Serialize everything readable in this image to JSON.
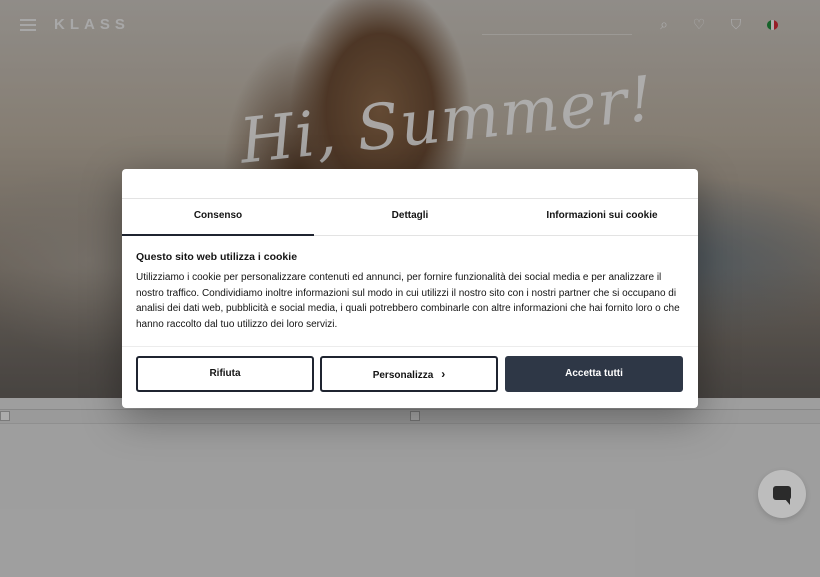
{
  "header": {
    "logo": "KLASS",
    "icons": [
      "menu-icon",
      "search-icon",
      "heart-icon",
      "cart-icon",
      "italian-flag-icon"
    ]
  },
  "hero": {
    "script_text": "Hi, Summer!"
  },
  "cookie_dialog": {
    "tabs": [
      {
        "label": "Consenso",
        "active": true
      },
      {
        "label": "Dettagli",
        "active": false
      },
      {
        "label": "Informazioni sui cookie",
        "active": false
      }
    ],
    "title": "Questo sito web utilizza i cookie",
    "body": "Utilizziamo i cookie per personalizzare contenuti ed annunci, per fornire funzionalità dei social media e per analizzare il nostro traffico. Condividiamo inoltre informazioni sul modo in cui utilizzi il nostro sito con i nostri partner che si occupano di analisi dei dati web, pubblicità e social media, i quali potrebbero combinarle con altre informazioni che hai fornito loro o che hanno raccolto dal tuo utilizzo dei loro servizi.",
    "buttons": {
      "reject": "Rifiuta",
      "customize": "Personalizza",
      "accept": "Accetta tutti"
    },
    "accent_color": "#2e3746"
  },
  "chat": {
    "icon": "chat-bubble-icon"
  }
}
